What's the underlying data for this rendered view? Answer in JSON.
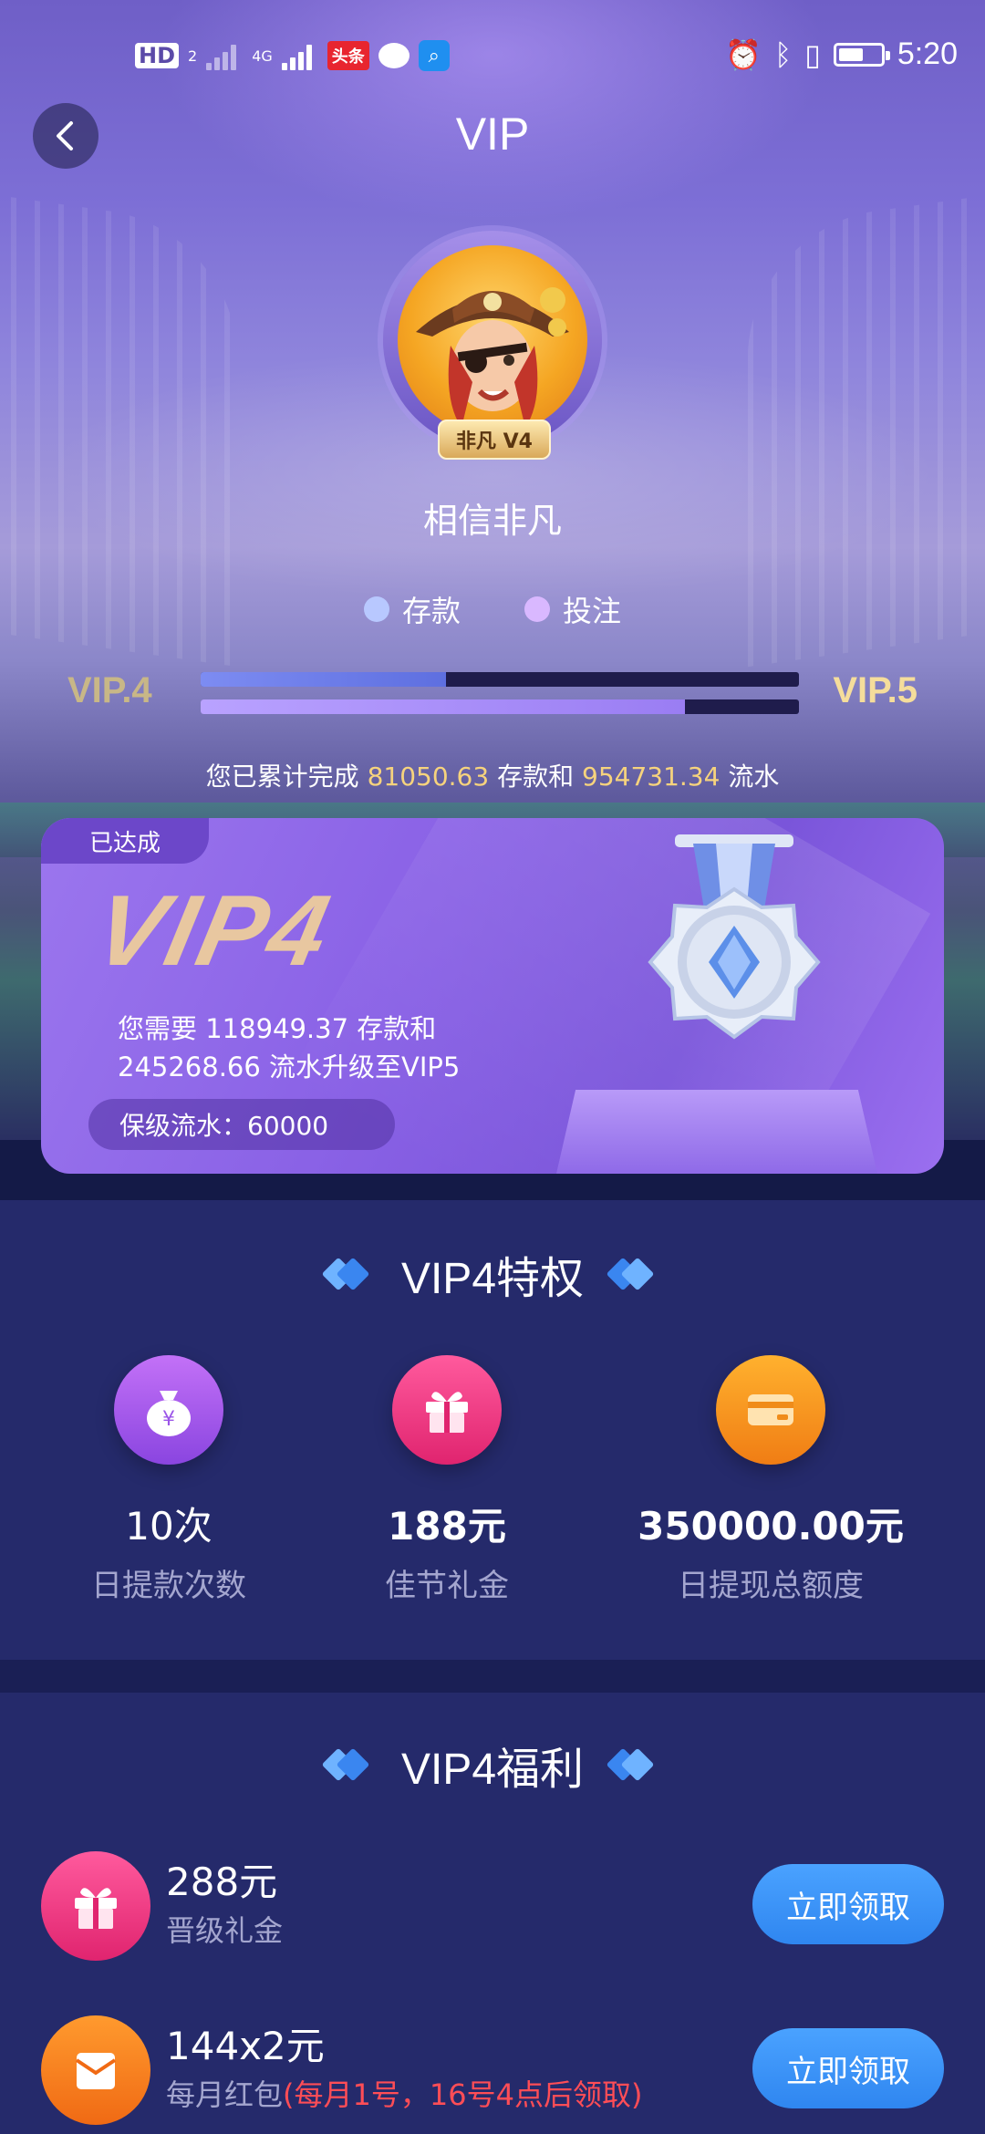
{
  "status_bar": {
    "hd": "HD",
    "hd_sim": "2",
    "network": "4G",
    "app_toutiao": "头条",
    "time": "5:20"
  },
  "header": {
    "title": "VIP"
  },
  "profile": {
    "badge": "非凡 V4",
    "username": "相信非凡"
  },
  "legend": {
    "deposit": "存款",
    "bet": "投注",
    "deposit_color": "#b8c8ff",
    "bet_color": "#d9b8ff"
  },
  "progress": {
    "current_level": "VIP.4",
    "next_level": "VIP.5",
    "deposit_fraction": 0.41,
    "bet_fraction": 0.81,
    "cumulative_prefix": "您已累计完成",
    "cumulative_deposit": "81050.63",
    "cumulative_mid": "存款和",
    "cumulative_flow": "954731.34",
    "cumulative_suffix": "流水"
  },
  "vip_card": {
    "achieved": "已达成",
    "level_title": "VIP4",
    "need_line1": "您需要 118949.37 存款和",
    "need_line2": "245268.66 流水升级至VIP5",
    "protect_flow": "保级流水：60000"
  },
  "privileges": {
    "title": "VIP4特权",
    "items": [
      {
        "icon": "money-bag-icon",
        "value": "10次",
        "label": "日提款次数"
      },
      {
        "icon": "gift-icon",
        "value": "188元",
        "label": "佳节礼金"
      },
      {
        "icon": "card-icon",
        "value": "350000.00元",
        "label": "日提现总额度"
      }
    ]
  },
  "benefits": {
    "title": "VIP4福利",
    "items": [
      {
        "icon": "gift-icon",
        "value": "288元",
        "label": "晋级礼金",
        "note": "",
        "button": "立即领取"
      },
      {
        "icon": "envelope-icon",
        "value": "144x2元",
        "label": "每月红包",
        "note": "(每月1号，16号4点后领取)",
        "button": "立即领取"
      }
    ]
  },
  "colors": {
    "accent_blue": "#3a8ff2",
    "gold": "#f6d37d",
    "note_red": "#ff4d56"
  }
}
